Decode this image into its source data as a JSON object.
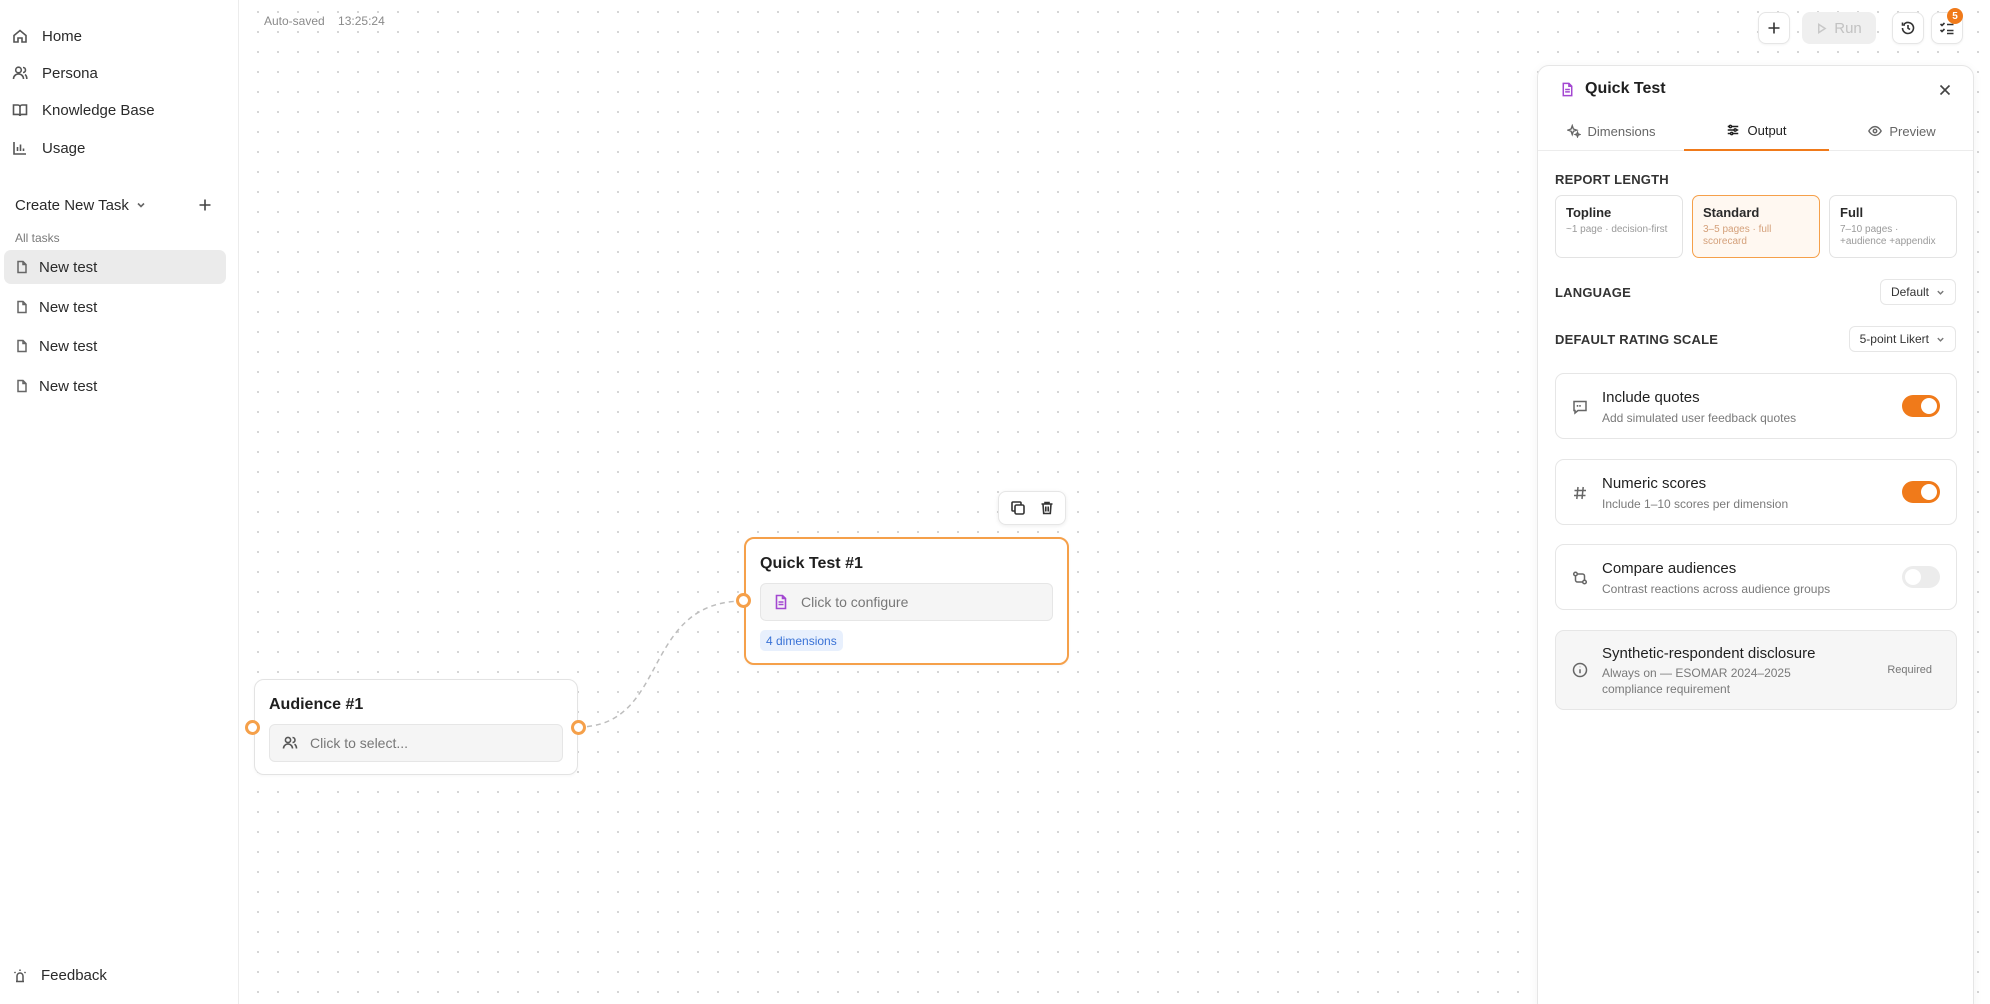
{
  "sidebar": {
    "nav": [
      {
        "label": "Home",
        "icon": "home-icon"
      },
      {
        "label": "Persona",
        "icon": "user-icon"
      },
      {
        "label": "Knowledge Base",
        "icon": "book-icon"
      },
      {
        "label": "Usage",
        "icon": "bar-chart-icon"
      }
    ],
    "create_label": "Create New Task",
    "all_tasks_label": "All tasks",
    "tasks": [
      {
        "label": "New test",
        "active": true
      },
      {
        "label": "New test",
        "active": false
      },
      {
        "label": "New test",
        "active": false
      },
      {
        "label": "New test",
        "active": false
      }
    ],
    "feedback_label": "Feedback"
  },
  "canvas": {
    "autosave_label": "Auto-saved",
    "autosave_time": "13:25:24",
    "run_label": "Run",
    "notification_count": "5",
    "nodes": {
      "audience": {
        "title": "Audience #1",
        "placeholder": "Click to select..."
      },
      "quick_test": {
        "title": "Quick Test #1",
        "placeholder": "Click to configure",
        "badge": "4 dimensions"
      }
    }
  },
  "panel": {
    "title": "Quick Test",
    "tabs": [
      {
        "label": "Dimensions",
        "icon": "sparkles-icon"
      },
      {
        "label": "Output",
        "icon": "sliders-icon",
        "active": true
      },
      {
        "label": "Preview",
        "icon": "eye-icon"
      }
    ],
    "report_length_label": "REPORT LENGTH",
    "report_lengths": [
      {
        "title": "Topline",
        "desc": "~1 page · decision-first"
      },
      {
        "title": "Standard",
        "desc": "3–5 pages · full scorecard",
        "active": true
      },
      {
        "title": "Full",
        "desc": "7–10 pages · +audience +appendix"
      }
    ],
    "language_label": "LANGUAGE",
    "language_value": "Default",
    "rating_scale_label": "DEFAULT RATING SCALE",
    "rating_scale_value": "5-point Likert",
    "options": [
      {
        "title": "Include quotes",
        "desc": "Add simulated user feedback quotes",
        "on": true
      },
      {
        "title": "Numeric scores",
        "desc": "Include 1–10 scores per dimension",
        "on": true
      },
      {
        "title": "Compare audiences",
        "desc": "Contrast reactions across audience groups",
        "on": false
      }
    ],
    "disclosure": {
      "title": "Synthetic-respondent disclosure",
      "desc": "Always on — ESOMAR 2024–2025 compliance requirement",
      "tag": "Required"
    }
  },
  "colors": {
    "accent": "#f07a1a",
    "node_border": "#f5a04a",
    "badge_blue": "#3972d6",
    "doc_purple": "#a347d1"
  }
}
